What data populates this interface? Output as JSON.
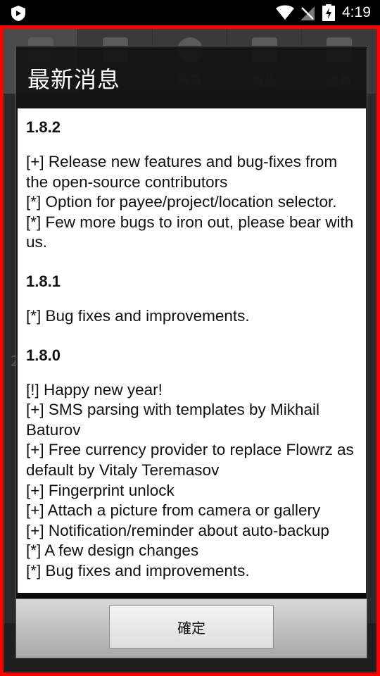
{
  "status_bar": {
    "time": "4:19"
  },
  "background_app": {
    "tabs": [
      "",
      "",
      "預算",
      "報告",
      "選單"
    ],
    "number_hint": "2"
  },
  "dialog": {
    "title": "最新消息",
    "ok_label": "確定",
    "sections": [
      {
        "version": "1.8.2",
        "lines": [
          "[+] Release new features and bug-fixes from the open-source contributors",
          "[*] Option for payee/project/location selector.",
          "[*] Few more bugs to iron out, please bear with us."
        ]
      },
      {
        "version": "1.8.1",
        "lines": [
          "[*] Bug fixes and improvements."
        ]
      },
      {
        "version": "1.8.0",
        "lines": [
          "[!] Happy new year!",
          "[+] SMS parsing with templates by Mikhail Baturov",
          "[+] Free currency provider to replace Flowrz as default by Vitaly Teremasov",
          "[+] Fingerprint unlock",
          "[+] Attach a picture from camera or gallery",
          "[+] Notification/reminder about auto-backup",
          "[*] A few design changes",
          "[*] Bug fixes and improvements."
        ]
      }
    ]
  }
}
